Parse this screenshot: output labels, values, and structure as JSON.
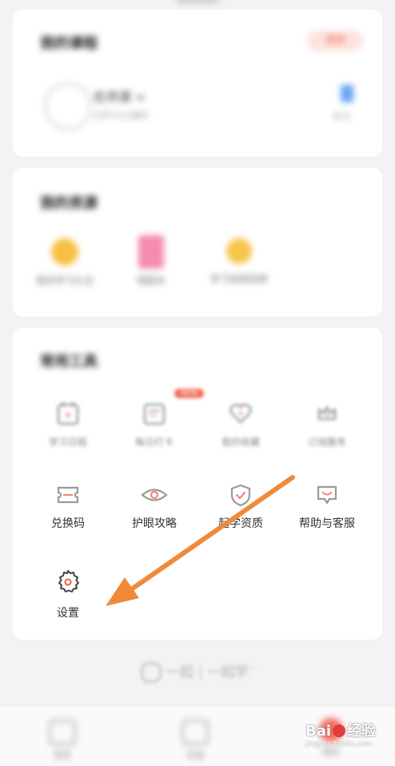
{
  "my_courses": {
    "title": "我的课程",
    "tag": "课程",
    "course_name": "名师课 >",
    "course_sub": "已学习12课时",
    "side_action": "学习"
  },
  "my_packs": {
    "title": "我的资源",
    "items": [
      {
        "label": "我的学习礼包",
        "icon": "gift-icon"
      },
      {
        "label": "错题本",
        "icon": "notebook-icon"
      },
      {
        "label": "学习成就勋章",
        "icon": "medal-icon"
      }
    ]
  },
  "services": {
    "title": "常用工具",
    "row1": [
      {
        "label": "学习日程",
        "icon": "calendar-icon"
      },
      {
        "label": "每日打卡",
        "icon": "checkin-icon",
        "badge": "NEW"
      },
      {
        "label": "我的收藏",
        "icon": "heart-icon"
      },
      {
        "label": "订阅服务",
        "icon": "crown-icon"
      }
    ],
    "row2": [
      {
        "label": "兑换码",
        "icon": "ticket-icon"
      },
      {
        "label": "护眼攻略",
        "icon": "eye-icon"
      },
      {
        "label": "起学资质",
        "icon": "shield-icon"
      },
      {
        "label": "帮助与客服",
        "icon": "headset-icon"
      }
    ],
    "settings": {
      "label": "设置",
      "icon": "gear-icon"
    }
  },
  "footer_logo": {
    "part1": "一起",
    "part2": "一起学",
    "tm": "™"
  },
  "tabbar": [
    {
      "label": "首页",
      "icon": "home-icon"
    },
    {
      "label": "乐园",
      "icon": "shop-icon"
    },
    {
      "label": "我的",
      "icon": "profile-icon"
    }
  ],
  "watermark": {
    "brand": "Bai",
    "brand2": "经验",
    "url": "jingyan.baidu.com"
  },
  "colors": {
    "accent": "#f26d5b",
    "arrow": "#f08a3a"
  }
}
